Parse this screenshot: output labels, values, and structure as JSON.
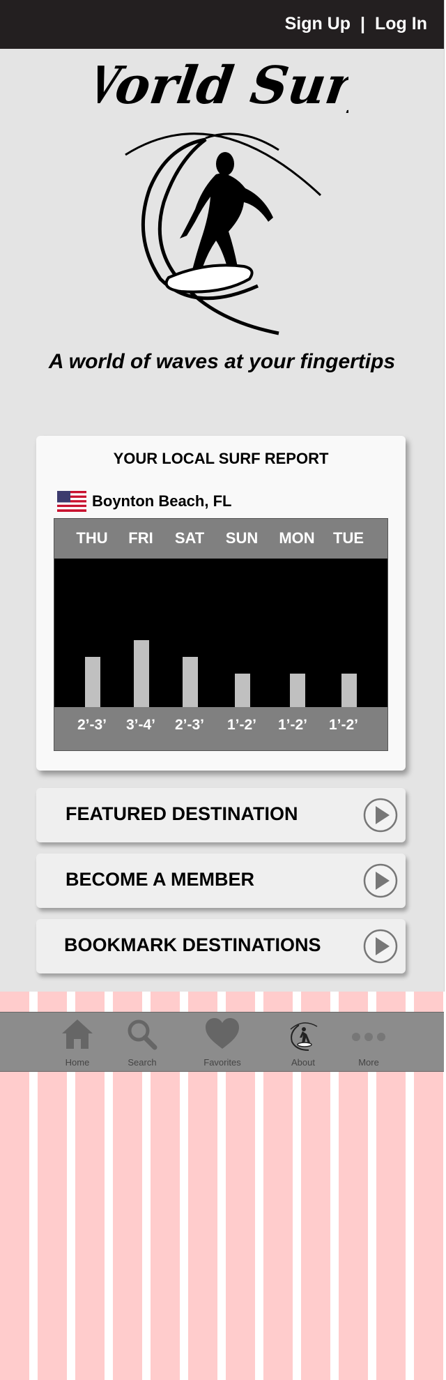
{
  "header": {
    "signup_label": "Sign Up",
    "separator": "|",
    "login_label": "Log In"
  },
  "logo": {
    "text": "World Surf"
  },
  "tagline": "A world of waves at your fingertips",
  "report": {
    "title": "YOUR LOCAL SURF REPORT",
    "location": "Boynton Beach, FL",
    "flag_icon": "us-flag-icon",
    "days": [
      "THU",
      "FRI",
      "SAT",
      "SUN",
      "MON",
      "TUE"
    ],
    "ranges": [
      "2’-3’",
      "3’-4’",
      "2’-3’",
      "1’-2’",
      "1’-2’",
      "1’-2’"
    ]
  },
  "chart_data": {
    "type": "bar",
    "categories": [
      "THU",
      "FRI",
      "SAT",
      "SUN",
      "MON",
      "TUE"
    ],
    "value_labels": [
      "2’-3’",
      "3’-4’",
      "2’-3’",
      "1’-2’",
      "1’-2’",
      "1’-2’"
    ],
    "values": [
      3,
      4,
      3,
      2,
      2,
      2
    ],
    "title": "",
    "xlabel": "",
    "ylabel": "",
    "grid": false
  },
  "actions": [
    {
      "label": "FEATURED DESTINATION",
      "icon": "play-icon"
    },
    {
      "label": "BECOME A MEMBER",
      "icon": "play-icon"
    },
    {
      "label": "BOOKMARK DESTINATIONS",
      "icon": "play-icon"
    }
  ],
  "nav": [
    {
      "label": "Home",
      "icon": "home-icon"
    },
    {
      "label": "Search",
      "icon": "search-icon"
    },
    {
      "label": "Favorites",
      "icon": "heart-icon"
    },
    {
      "label": "About",
      "icon": "surfer-logo-icon"
    },
    {
      "label": "More",
      "icon": "more-dots-icon"
    }
  ],
  "colors": {
    "topbar": "#231f20",
    "background": "#e4e4e4",
    "chart_header": "#808080",
    "chart_body": "#000000",
    "bar": "#c0c0c0",
    "stripe": "#ffcccc",
    "navbar": "#8c8c8c"
  }
}
